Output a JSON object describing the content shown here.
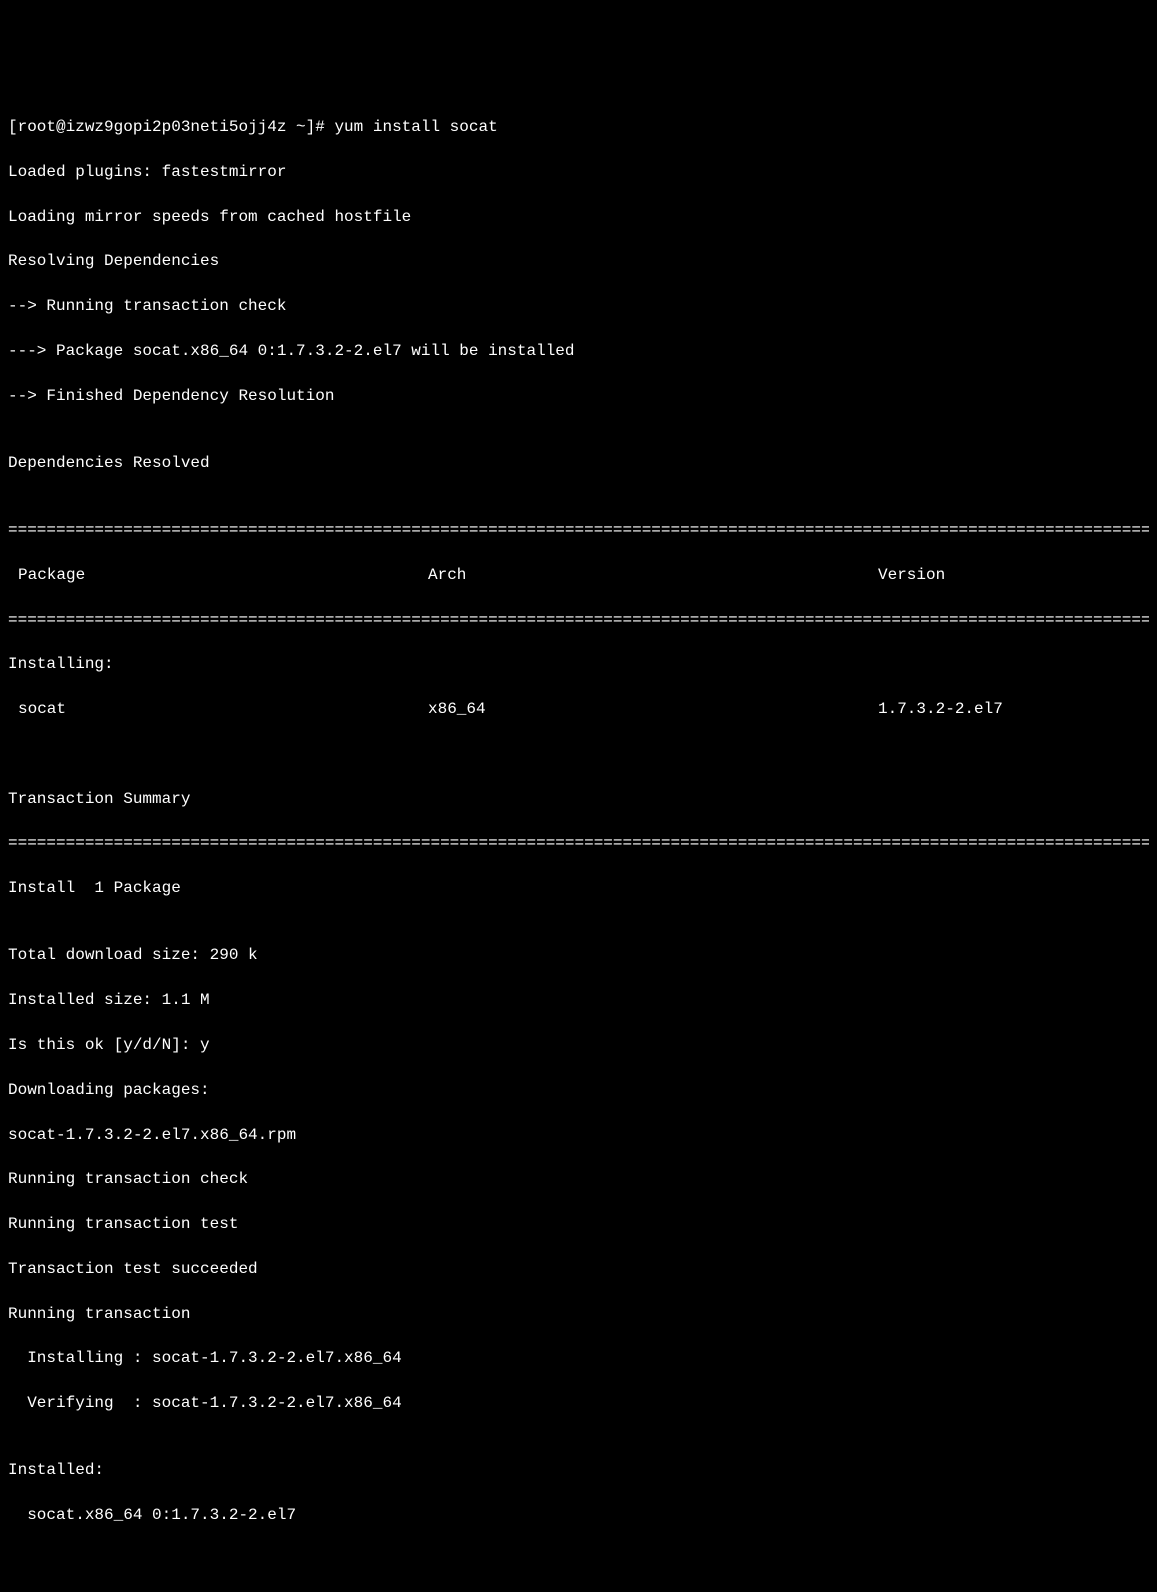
{
  "terminal": {
    "prompt": "[root@izwz9gopi2p03neti5ojj4z ~]# ",
    "command": "yum install socat",
    "lines_pre": [
      "Loaded plugins: fastestmirror",
      "Loading mirror speeds from cached hostfile",
      "Resolving Dependencies",
      "--> Running transaction check",
      "---> Package socat.x86_64 0:1.7.3.2-2.el7 will be installed",
      "--> Finished Dependency Resolution",
      "",
      "Dependencies Resolved",
      ""
    ],
    "table_header": {
      "package": "Package",
      "arch": "Arch",
      "version": "Version"
    },
    "installing_label": "Installing:",
    "table_row": {
      "package": "socat",
      "arch": "x86_64",
      "version": "1.7.3.2-2.el7"
    },
    "transaction_summary_label": "Transaction Summary",
    "install_summary": "Install  1 Package",
    "lines_post": [
      "",
      "Total download size: 290 k",
      "Installed size: 1.1 M",
      "Is this ok [y/d/N]: y",
      "Downloading packages:",
      "socat-1.7.3.2-2.el7.x86_64.rpm",
      "Running transaction check",
      "Running transaction test",
      "Transaction test succeeded",
      "Running transaction",
      "  Installing : socat-1.7.3.2-2.el7.x86_64",
      "  Verifying  : socat-1.7.3.2-2.el7.x86_64",
      "",
      "Installed:",
      "  socat.x86_64 0:1.7.3.2-2.el7"
    ],
    "divider": "========================================================================================================================"
  }
}
